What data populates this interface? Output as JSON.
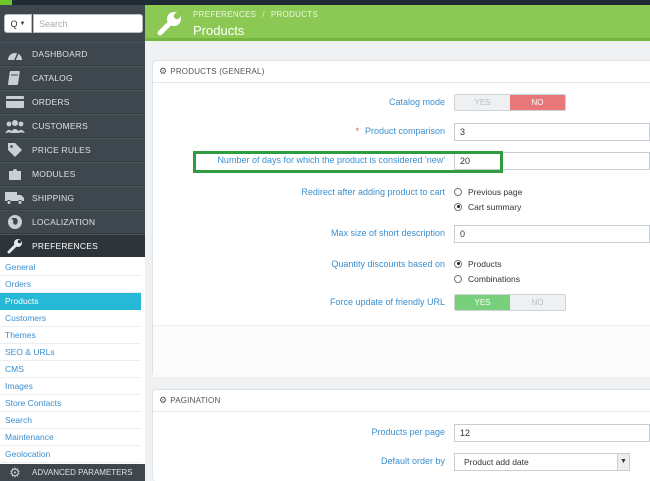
{
  "sidebar": {
    "search_placeholder": "Search",
    "search_icon_glyph": "Q",
    "nav": [
      {
        "label": "DASHBOARD",
        "icon": "dashboard-icon"
      },
      {
        "label": "CATALOG",
        "icon": "catalog-icon"
      },
      {
        "label": "ORDERS",
        "icon": "orders-icon"
      },
      {
        "label": "CUSTOMERS",
        "icon": "customers-icon"
      },
      {
        "label": "PRICE RULES",
        "icon": "price-rules-icon"
      },
      {
        "label": "MODULES",
        "icon": "modules-icon"
      },
      {
        "label": "SHIPPING",
        "icon": "shipping-icon"
      },
      {
        "label": "LOCALIZATION",
        "icon": "localization-icon"
      },
      {
        "label": "PREFERENCES",
        "icon": "wrench-icon"
      }
    ],
    "subnav": [
      "General",
      "Orders",
      "Products",
      "Customers",
      "Themes",
      "SEO & URLs",
      "CMS",
      "Images",
      "Store Contacts",
      "Search",
      "Maintenance",
      "Geolocation"
    ],
    "bottom": {
      "label": "ADVANCED PARAMETERS",
      "icon": "gears-icon"
    }
  },
  "header": {
    "breadcrumb": [
      "PREFERENCES",
      "PRODUCTS"
    ],
    "breadcrumb_sep": "/",
    "title": "Products"
  },
  "general": {
    "heading": "PRODUCTS (GENERAL)",
    "catalog_mode": {
      "label": "Catalog mode",
      "yes": "YES",
      "no": "NO",
      "selected": "NO"
    },
    "product_comparison": {
      "label": "Product comparison",
      "required_mark": "*",
      "value": "3"
    },
    "new_days": {
      "label": "Number of days for which the product is considered 'new'",
      "value": "20"
    },
    "redirect": {
      "label": "Redirect after adding product to cart",
      "options": [
        "Previous page",
        "Cart summary"
      ],
      "selected": "Cart summary"
    },
    "short_desc": {
      "label": "Max size of short description",
      "value": "0"
    },
    "qty_discounts": {
      "label": "Quantity discounts based on",
      "options": [
        "Products",
        "Combinations"
      ],
      "selected": "Products"
    },
    "friendly_url": {
      "label": "Force update of friendly URL",
      "yes": "YES",
      "no": "NO",
      "selected": "YES"
    }
  },
  "pagination": {
    "heading": "PAGINATION",
    "per_page": {
      "label": "Products per page",
      "value": "12"
    },
    "default_order": {
      "label": "Default order by",
      "value": "Product add date"
    }
  },
  "colors": {
    "accent": "#8bc954",
    "active_sub": "#25b9d7",
    "highlight": "#2e9c3f"
  }
}
